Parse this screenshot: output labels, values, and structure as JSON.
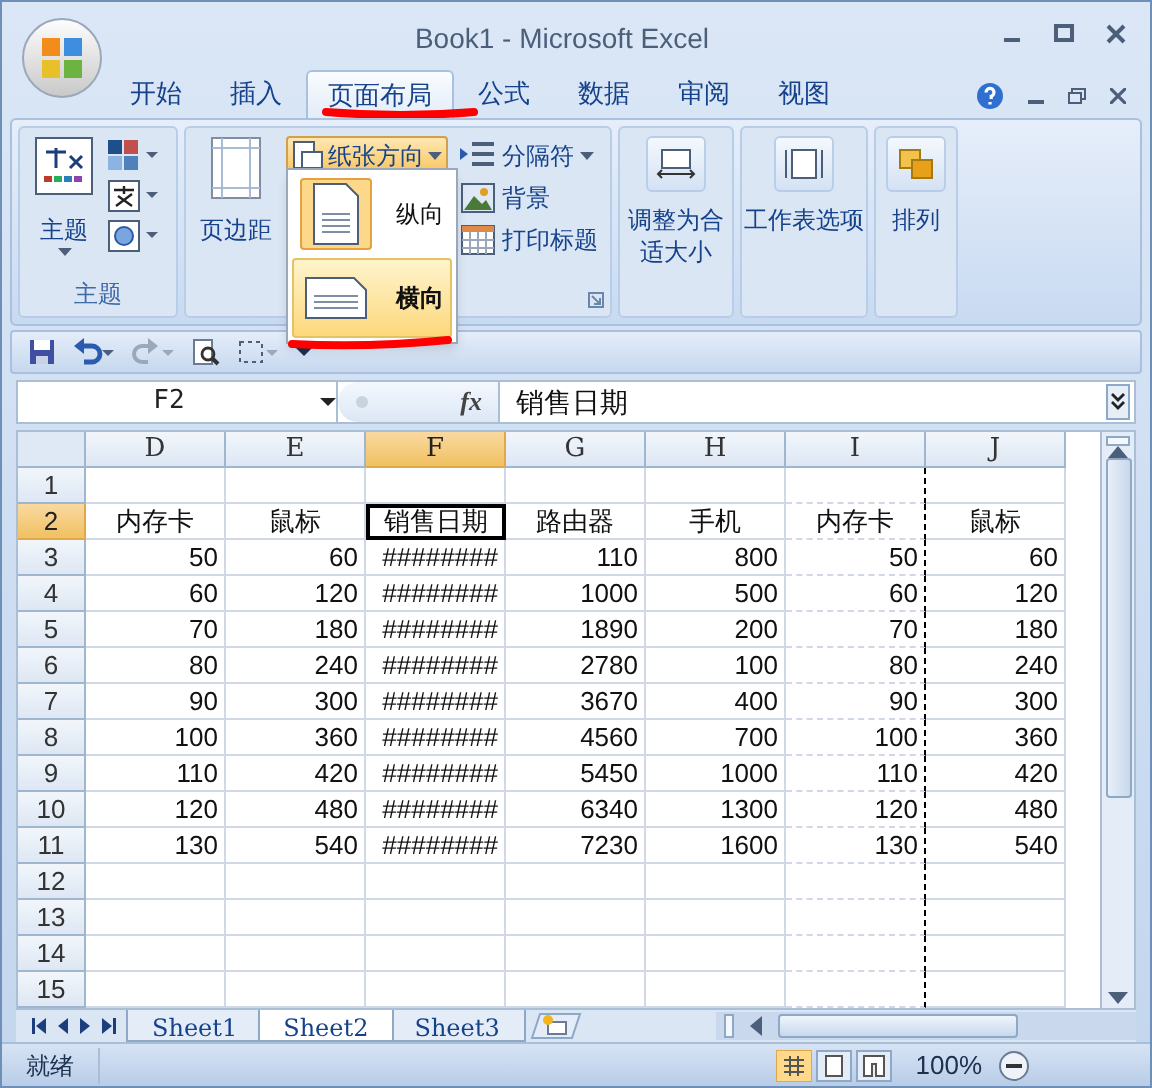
{
  "window": {
    "title": "Book1 - Microsoft Excel"
  },
  "ribbon_tabs": [
    {
      "label": "开始",
      "selected": false
    },
    {
      "label": "插入",
      "selected": false
    },
    {
      "label": "页面布局",
      "selected": true
    },
    {
      "label": "公式",
      "selected": false
    },
    {
      "label": "数据",
      "selected": false
    },
    {
      "label": "审阅",
      "selected": false
    },
    {
      "label": "视图",
      "selected": false
    }
  ],
  "ribbon": {
    "themes_group": {
      "label": "主题",
      "button": "主题"
    },
    "page_setup_group": {
      "margins": "页边距",
      "orientation": {
        "label": "纸张方向",
        "expanded": true
      },
      "small_buttons": [
        "分隔符",
        "背景",
        "打印标题"
      ]
    },
    "groups": [
      "调整为合适大小",
      "工作表选项",
      "排列"
    ]
  },
  "orientation_menu": [
    {
      "label": "纵向",
      "selected": true,
      "hovered": false
    },
    {
      "label": "横向",
      "selected": false,
      "hovered": true
    }
  ],
  "formula_bar": {
    "name_box": "F2",
    "fx": "fx",
    "value": "销售日期"
  },
  "columns": [
    {
      "label": "D",
      "selected": false
    },
    {
      "label": "E",
      "selected": false
    },
    {
      "label": "F",
      "selected": true
    },
    {
      "label": "G",
      "selected": false
    },
    {
      "label": "H",
      "selected": false
    },
    {
      "label": "I",
      "selected": false
    },
    {
      "label": "J",
      "selected": false
    }
  ],
  "rows": [
    {
      "number": "1",
      "selected": false
    },
    {
      "number": "2",
      "selected": true,
      "kind": "header",
      "cells": [
        "内存卡",
        "鼠标",
        "销售日期",
        "路由器",
        "手机",
        "内存卡",
        "鼠标"
      ]
    },
    {
      "number": "3",
      "selected": false,
      "kind": "data",
      "cells": [
        "50",
        "60",
        "########",
        "110",
        "800",
        "50",
        "60"
      ]
    },
    {
      "number": "4",
      "selected": false,
      "kind": "data",
      "cells": [
        "60",
        "120",
        "########",
        "1000",
        "500",
        "60",
        "120"
      ]
    },
    {
      "number": "5",
      "selected": false,
      "kind": "data",
      "cells": [
        "70",
        "180",
        "########",
        "1890",
        "200",
        "70",
        "180"
      ]
    },
    {
      "number": "6",
      "selected": false,
      "kind": "data",
      "cells": [
        "80",
        "240",
        "########",
        "2780",
        "100",
        "80",
        "240"
      ]
    },
    {
      "number": "7",
      "selected": false,
      "kind": "data",
      "cells": [
        "90",
        "300",
        "########",
        "3670",
        "400",
        "90",
        "300"
      ]
    },
    {
      "number": "8",
      "selected": false,
      "kind": "data",
      "cells": [
        "100",
        "360",
        "########",
        "4560",
        "700",
        "100",
        "360"
      ]
    },
    {
      "number": "9",
      "selected": false,
      "kind": "data",
      "cells": [
        "110",
        "420",
        "########",
        "5450",
        "1000",
        "110",
        "420"
      ]
    },
    {
      "number": "10",
      "selected": false,
      "kind": "data",
      "cells": [
        "120",
        "480",
        "########",
        "6340",
        "1300",
        "120",
        "480"
      ]
    },
    {
      "number": "11",
      "selected": false,
      "kind": "data",
      "cells": [
        "130",
        "540",
        "########",
        "7230",
        "1600",
        "130",
        "540"
      ]
    },
    {
      "number": "12",
      "selected": false
    },
    {
      "number": "13",
      "selected": false
    },
    {
      "number": "14",
      "selected": false
    },
    {
      "number": "15",
      "selected": false
    }
  ],
  "sheet_tabs": [
    {
      "label": "Sheet1",
      "selected": false
    },
    {
      "label": "Sheet2",
      "selected": true
    },
    {
      "label": "Sheet3",
      "selected": false
    }
  ],
  "status_bar": {
    "status": "就绪",
    "zoom": "100%"
  }
}
